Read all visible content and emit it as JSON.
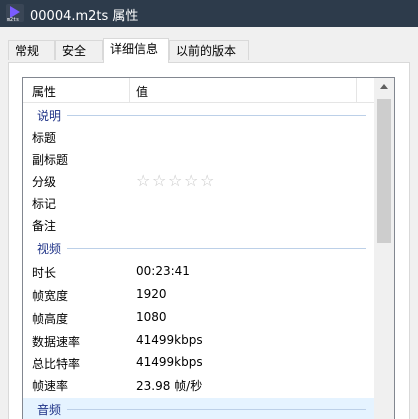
{
  "window": {
    "title": "00004.m2ts 属性",
    "icon": "video-file-icon",
    "icon_tag": "m2ts"
  },
  "tabs": [
    {
      "label": "常规",
      "active": false
    },
    {
      "label": "安全",
      "active": false
    },
    {
      "label": "详细信息",
      "active": true
    },
    {
      "label": "以前的版本",
      "active": false
    }
  ],
  "columns": {
    "property": "属性",
    "value": "值"
  },
  "groups": [
    {
      "title": "说明",
      "rows": [
        {
          "key": "标题",
          "value": ""
        },
        {
          "key": "副标题",
          "value": ""
        },
        {
          "key": "分级",
          "value": "",
          "stars_total": 5,
          "stars_filled": 0
        },
        {
          "key": "标记",
          "value": ""
        },
        {
          "key": "备注",
          "value": ""
        }
      ]
    },
    {
      "title": "视频",
      "rows": [
        {
          "key": "时长",
          "value": "00:23:41"
        },
        {
          "key": "帧宽度",
          "value": "1920"
        },
        {
          "key": "帧高度",
          "value": "1080"
        },
        {
          "key": "数据速率",
          "value": "41499kbps"
        },
        {
          "key": "总比特率",
          "value": "41499kbps"
        },
        {
          "key": "帧速率",
          "value": "23.98 帧/秒"
        }
      ]
    },
    {
      "title": "音频",
      "rows": []
    }
  ],
  "colors": {
    "titlebar": "#2d3b4b",
    "group_title": "#1e3287",
    "star_empty": "#c8c8c8",
    "highlight": "#e5f3ff"
  }
}
